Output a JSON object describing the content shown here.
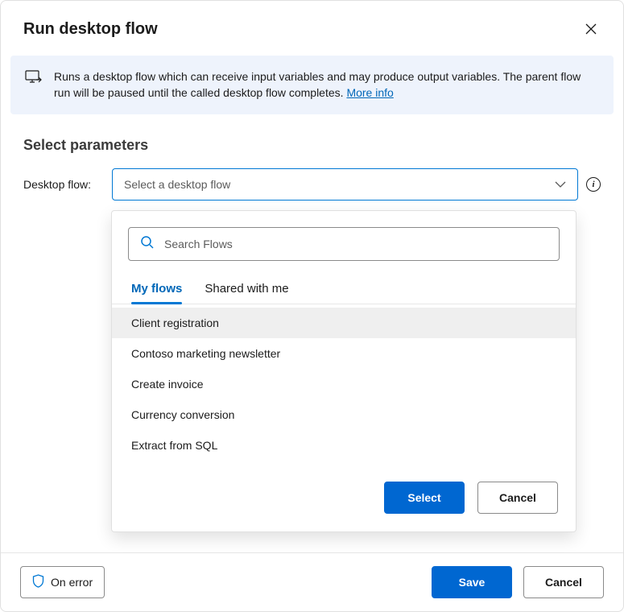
{
  "dialog": {
    "title": "Run desktop flow",
    "info_text_prefix": "Runs a desktop flow which can receive input variables and may produce output variables. The parent flow run will be paused until the called desktop flow completes. ",
    "info_link": "More info"
  },
  "parameters": {
    "section_title": "Select parameters",
    "field_label": "Desktop flow:",
    "dropdown_placeholder": "Select a desktop flow"
  },
  "popup": {
    "search_placeholder": "Search Flows",
    "tabs": {
      "my_flows": "My flows",
      "shared": "Shared with me"
    },
    "flows": [
      "Client registration",
      "Contoso marketing newsletter",
      "Create invoice",
      "Currency conversion",
      "Extract from SQL"
    ],
    "select_label": "Select",
    "cancel_label": "Cancel"
  },
  "footer": {
    "on_error_label": "On error",
    "save_label": "Save",
    "cancel_label": "Cancel"
  }
}
